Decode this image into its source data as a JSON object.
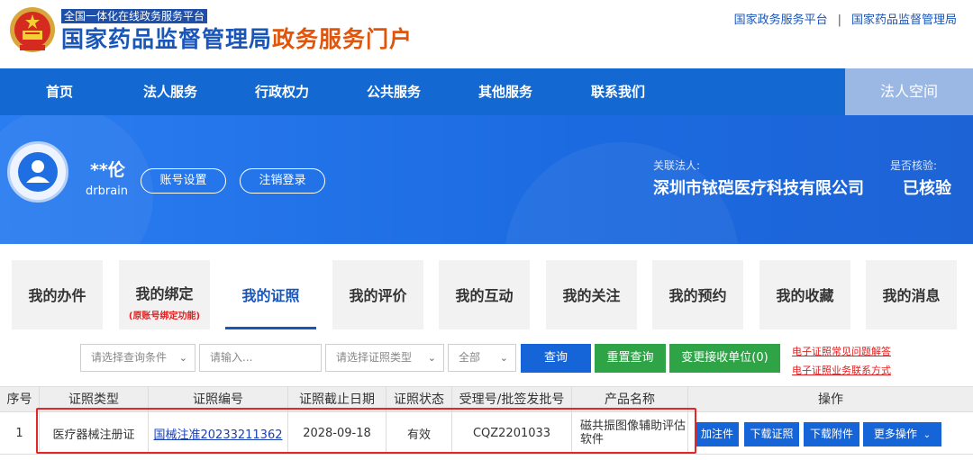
{
  "header": {
    "sub_title": "全国一体化在线政务服务平台",
    "title_main": "国家药品监督管理局",
    "title_accent": "政务服务门户",
    "links": [
      "国家政务服务平台",
      "国家药品监督管理局"
    ],
    "link_separator": "|"
  },
  "nav": {
    "items": [
      "首页",
      "法人服务",
      "行政权力",
      "公共服务",
      "其他服务",
      "联系我们"
    ],
    "space_label": "法人空间"
  },
  "profile": {
    "name": "**伦",
    "account": "drbrain",
    "settings_button": "账号设置",
    "logout_button": "注销登录",
    "related_label": "关联法人:",
    "related_value": "深圳市铱硙医疗科技有限公司",
    "verified_label": "是否核验:",
    "verified_value": "已核验"
  },
  "tabs": [
    {
      "label": "我的办件"
    },
    {
      "label": "我的绑定",
      "note": "(原账号绑定功能)"
    },
    {
      "label": "我的证照",
      "active": true
    },
    {
      "label": "我的评价"
    },
    {
      "label": "我的互动"
    },
    {
      "label": "我的关注"
    },
    {
      "label": "我的预约"
    },
    {
      "label": "我的收藏"
    },
    {
      "label": "我的消息"
    }
  ],
  "filters": {
    "condition_placeholder": "请选择查询条件",
    "input_placeholder": "请输入...",
    "type_placeholder": "请选择证照类型",
    "scope_value": "全部",
    "query_button": "查询",
    "reset_button": "重置查询",
    "change_unit_button": "变更接收单位(0)",
    "help_links": [
      "电子证照常见问题解答",
      "电子证照业务联系方式"
    ]
  },
  "table": {
    "headers": [
      "序号",
      "证照类型",
      "证照编号",
      "证照截止日期",
      "证照状态",
      "受理号/批签发批号",
      "产品名称",
      "操作"
    ],
    "rows": [
      {
        "index": "1",
        "type": "医疗器械注册证",
        "number": "国械注准20233211362",
        "expiry": "2028-09-18",
        "status": "有效",
        "accept_no": "CQZ2201033",
        "product": "磁共振图像辅助评估软件"
      }
    ],
    "actions": [
      "加注件",
      "下载证照",
      "下载附件",
      "更多操作"
    ]
  },
  "colors": {
    "brand_blue": "#1368d1",
    "accent_orange": "#e0550b",
    "highlight_red": "#e32626",
    "button_green": "#2ea447"
  }
}
